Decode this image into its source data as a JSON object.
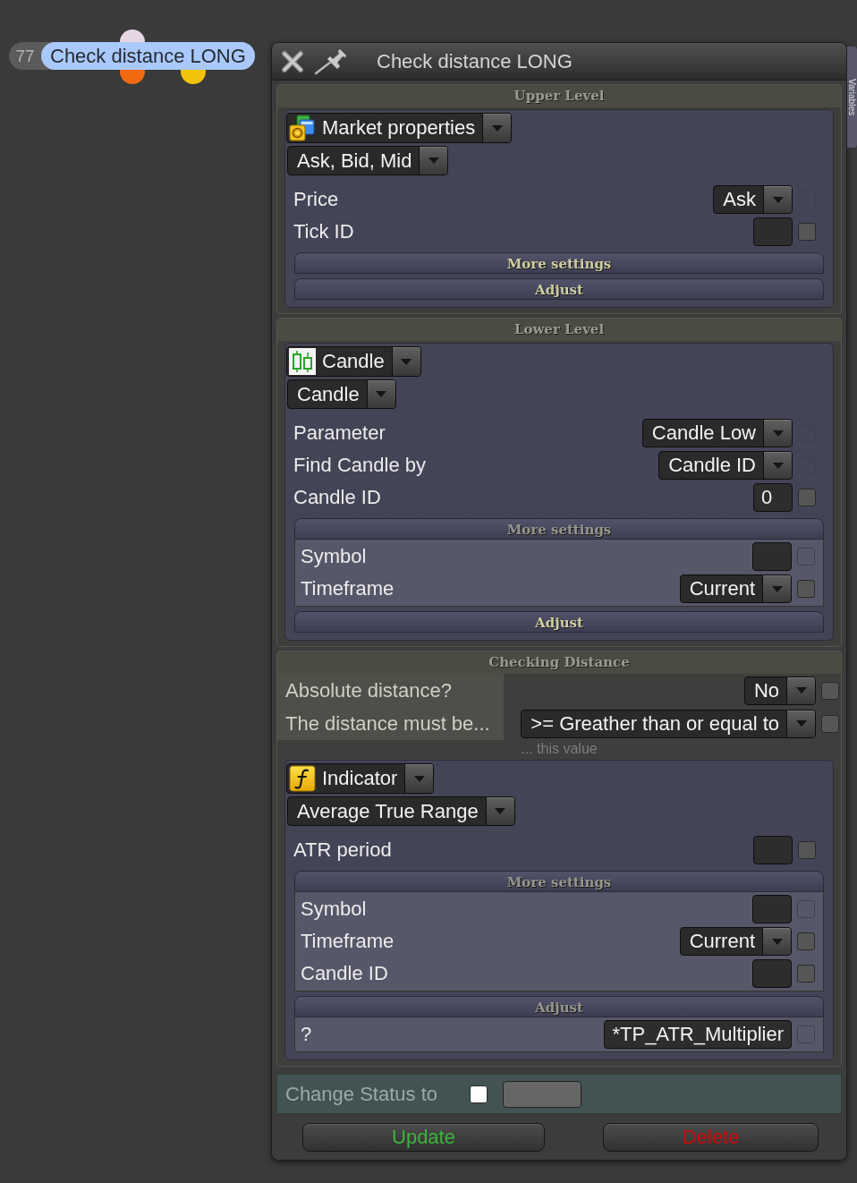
{
  "node": {
    "number": "77",
    "title": "Check distance LONG"
  },
  "panel": {
    "title": "Check distance LONG",
    "side_tab": "Variables"
  },
  "sections": [
    {
      "title": "Upper Level",
      "block": {
        "source": {
          "kind": "market",
          "label": "Market properties"
        },
        "function": "Ask, Bid, Mid",
        "params": [
          {
            "label": "Price",
            "kind": "select",
            "value": "Ask",
            "checkbox": {
              "checked": false,
              "disabled": true
            }
          },
          {
            "label": "Tick ID",
            "kind": "input",
            "checkbox": {
              "checked": false,
              "disabled": false
            }
          }
        ],
        "groups": [
          {
            "title": "More settings",
            "expanded": false
          },
          {
            "title": "Adjust",
            "expanded": false
          }
        ]
      }
    },
    {
      "title": "Lower Level",
      "block": {
        "source": {
          "kind": "candle",
          "label": "Candle"
        },
        "function": "Candle",
        "params": [
          {
            "label": "Parameter",
            "kind": "select",
            "value": "Candle Low",
            "checkbox": {
              "checked": false,
              "disabled": true
            }
          },
          {
            "label": "Find Candle by",
            "kind": "select",
            "value": "Candle ID",
            "checkbox": {
              "checked": false,
              "disabled": true
            }
          },
          {
            "label": "Candle ID",
            "kind": "input",
            "value": "0",
            "checkbox": {
              "checked": false,
              "disabled": false
            }
          }
        ],
        "groups": [
          {
            "title": "More settings",
            "expanded": true,
            "params": [
              {
                "label": "Symbol",
                "kind": "input",
                "checkbox": {
                  "checked": false,
                  "disabled": true
                }
              },
              {
                "label": "Timeframe",
                "kind": "select",
                "value": "Current",
                "checkbox": {
                  "checked": false,
                  "disabled": false
                }
              }
            ]
          },
          {
            "title": "Adjust",
            "expanded": false
          }
        ]
      }
    },
    {
      "title": "Checking Distance",
      "fields": [
        {
          "label": "Absolute distance?",
          "kind": "select",
          "value": "No",
          "checkbox": {
            "checked": false,
            "disabled": false
          }
        },
        {
          "label": "The distance must be...",
          "kind": "select",
          "value": ">= Greather than or equal to",
          "checkbox": {
            "checked": false,
            "disabled": false
          }
        }
      ],
      "hint": "... this value",
      "block": {
        "source": {
          "kind": "indicator",
          "label": "Indicator"
        },
        "function": "Average True Range",
        "params": [
          {
            "label": "ATR period",
            "kind": "input",
            "checkbox": {
              "checked": false,
              "disabled": false
            }
          }
        ],
        "groups": [
          {
            "title": "More settings",
            "expanded": true,
            "params": [
              {
                "label": "Symbol",
                "kind": "input",
                "checkbox": {
                  "checked": false,
                  "disabled": true
                }
              },
              {
                "label": "Timeframe",
                "kind": "select",
                "value": "Current",
                "checkbox": {
                  "checked": false,
                  "disabled": false
                }
              },
              {
                "label": "Candle ID",
                "kind": "input",
                "checkbox": {
                  "checked": false,
                  "disabled": false
                }
              }
            ]
          },
          {
            "title": "Adjust",
            "expanded": true,
            "params": [
              {
                "label": "?",
                "kind": "input",
                "value": "*TP_ATR_Multiplier",
                "checkbox": {
                  "checked": false,
                  "disabled": true
                }
              }
            ]
          }
        ]
      }
    }
  ],
  "status": {
    "label": "Change Status to",
    "checked": false
  },
  "buttons": [
    {
      "label": "Update",
      "kind": "update"
    },
    {
      "label": "Delete",
      "kind": "delete"
    }
  ]
}
